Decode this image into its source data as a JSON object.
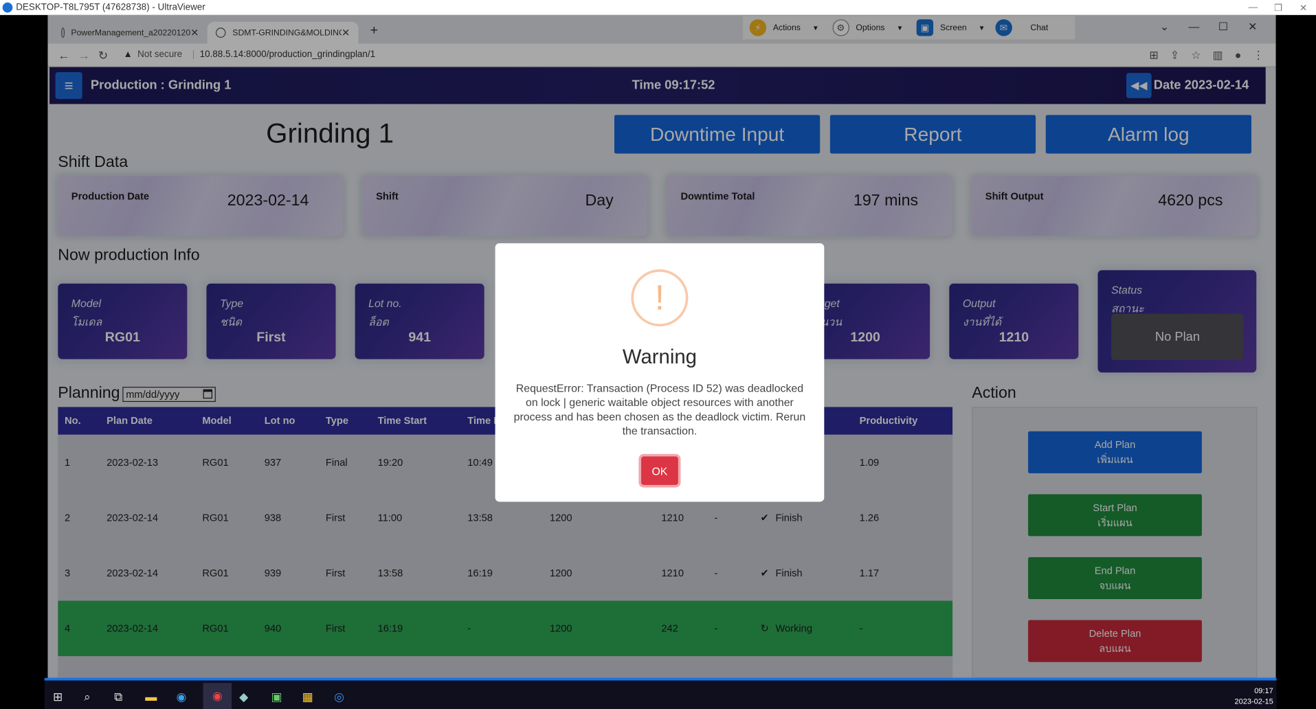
{
  "remote": {
    "title": "DESKTOP-T8L795T (47628738) - UltraViewer"
  },
  "browser": {
    "tabs": [
      {
        "label": "PowerManagement_a20220120"
      },
      {
        "label": "SDMT-GRINDING&MOLDING_V"
      }
    ],
    "not_secure": "Not secure",
    "url": "10.88.5.14:8000/production_grindingplan/1"
  },
  "uv_toolbar": {
    "actions": "Actions",
    "options": "Options",
    "screen": "Screen",
    "chat": "Chat"
  },
  "nav": {
    "title": "Production : Grinding 1",
    "time": "Time 09:17:52",
    "date": "Date 2023-02-14"
  },
  "page": {
    "title": "Grinding 1",
    "buttons": {
      "downtime": "Downtime Input",
      "report": "Report",
      "alarm": "Alarm log"
    },
    "shift_section": "Shift Data",
    "shift": {
      "production_date": {
        "label": "Production Date",
        "value": "2023-02-14"
      },
      "shift": {
        "label": "Shift",
        "value": "Day"
      },
      "downtime": {
        "label": "Downtime Total",
        "value": "197 mins"
      },
      "output": {
        "label": "Shift Output",
        "value": "4620 pcs"
      }
    },
    "now_section": "Now production Info",
    "now": {
      "model": {
        "l1": "Model",
        "l2": "โมเดล",
        "value": "RG01"
      },
      "type": {
        "l1": "Type",
        "l2": "ชนิด",
        "value": "First"
      },
      "lot": {
        "l1": "Lot no.",
        "l2": "ล็อต",
        "value": "941"
      },
      "target": {
        "l1": "rget",
        "l2": "นวน",
        "value": "1200"
      },
      "output": {
        "l1": "Output",
        "l2": "งานที่ได้",
        "value": "1210"
      },
      "status": {
        "l1": "Status",
        "l2": "สถานะ",
        "value": "No Plan"
      }
    },
    "planning": {
      "title": "Planning",
      "date_placeholder": "mm/dd/yyyy"
    },
    "table": {
      "headers": {
        "no": "No.",
        "plan_date": "Plan Date",
        "model": "Model",
        "lot": "Lot no",
        "type": "Type",
        "start": "Time Start",
        "end": "Time E",
        "productivity": "Productivity"
      },
      "rows": [
        {
          "no": "1",
          "date": "2023-02-13",
          "model": "RG01",
          "lot": "937",
          "type": "Final",
          "start": "19:20",
          "end": "10:49",
          "target": "",
          "output": "",
          "dash": "",
          "status": "",
          "prod": "1.09"
        },
        {
          "no": "2",
          "date": "2023-02-14",
          "model": "RG01",
          "lot": "938",
          "type": "First",
          "start": "11:00",
          "end": "13:58",
          "target": "1200",
          "output": "1210",
          "dash": "-",
          "status": "Finish",
          "prod": "1.26"
        },
        {
          "no": "3",
          "date": "2023-02-14",
          "model": "RG01",
          "lot": "939",
          "type": "First",
          "start": "13:58",
          "end": "16:19",
          "target": "1200",
          "output": "1210",
          "dash": "-",
          "status": "Finish",
          "prod": "1.17"
        },
        {
          "no": "4",
          "date": "2023-02-14",
          "model": "RG01",
          "lot": "940",
          "type": "First",
          "start": "16:19",
          "end": "-",
          "target": "1200",
          "output": "242",
          "dash": "-",
          "status": "Working",
          "prod": "-"
        }
      ]
    },
    "action": {
      "title": "Action",
      "add": {
        "l1": "Add Plan",
        "l2": "เพิ่มแผน"
      },
      "start": {
        "l1": "Start Plan",
        "l2": "เริ่มแผน"
      },
      "end": {
        "l1": "End Plan",
        "l2": "จบแผน"
      },
      "delete": {
        "l1": "Delete Plan",
        "l2": "ลบแผน"
      }
    }
  },
  "modal": {
    "icon": "!",
    "title": "Warning",
    "message": "RequestError: Transaction (Process ID 52) was deadlocked on lock | generic waitable object resources with another process and has been chosen as the deadlock victim. Rerun the transaction.",
    "ok": "OK"
  },
  "taskbar": {
    "time": "09:17",
    "date": "2023-02-15"
  }
}
